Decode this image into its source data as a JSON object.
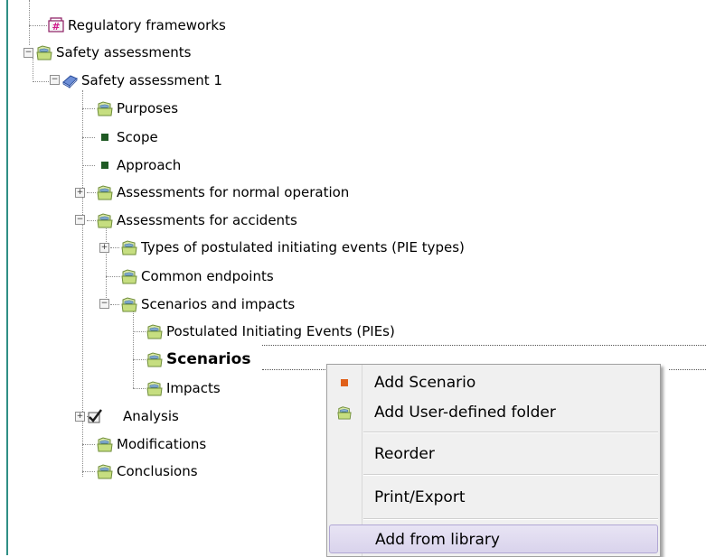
{
  "tree": {
    "regulatory_frameworks": "Regulatory frameworks",
    "safety_assessments": "Safety assessments",
    "safety_assessment_1": "Safety assessment 1",
    "purposes": "Purposes",
    "scope": "Scope",
    "approach": "Approach",
    "normal_operation": "Assessments for normal operation",
    "accidents": "Assessments for accidents",
    "pie_types": "Types of postulated initiating events (PIE types)",
    "common_endpoints": "Common endpoints",
    "scenarios_impacts": "Scenarios and impacts",
    "pies": "Postulated Initiating Events (PIEs)",
    "scenarios": "Scenarios",
    "impacts": "Impacts",
    "analysis": "Analysis",
    "modifications": "Modifications",
    "conclusions": "Conclusions"
  },
  "context_menu": {
    "add_scenario": "Add Scenario",
    "add_user_folder": "Add User-defined folder",
    "reorder": "Reorder",
    "print_export": "Print/Export",
    "add_from_library": "Add from library"
  },
  "icons": {
    "folder": "folder-icon",
    "book": "book-icon",
    "bullet": "green-square-icon",
    "checkbox": "checkmark-icon",
    "framework": "framework-icon",
    "scenario": "orange-square-icon"
  },
  "colors": {
    "accent_line": "#2f8f85",
    "menu_bg": "#f0f0f0",
    "hover": "#d9d3ec"
  }
}
